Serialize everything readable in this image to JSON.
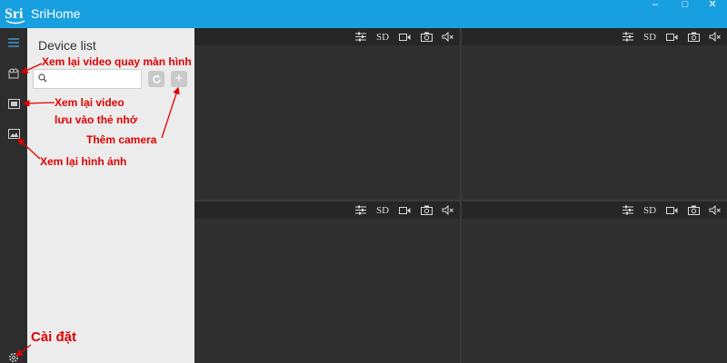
{
  "app": {
    "title": "SriHome",
    "logo_text": "Sri"
  },
  "window_controls": {
    "minimize": "–",
    "maximize": "□",
    "close": "✕"
  },
  "sidebar": {
    "items": [
      {
        "icon": "list-icon"
      },
      {
        "icon": "recording-icon"
      },
      {
        "icon": "film-icon"
      },
      {
        "icon": "image-icon"
      },
      {
        "icon": "gear-icon"
      }
    ]
  },
  "device_panel": {
    "title": "Device list",
    "search": {
      "value": "",
      "placeholder": ""
    },
    "refresh_icon": "refresh-icon",
    "add_label": "+"
  },
  "video_tiles": [
    {
      "quality": "SD"
    },
    {
      "quality": "SD"
    },
    {
      "quality": "SD"
    },
    {
      "quality": "SD"
    }
  ],
  "annotations": {
    "screen_recording": "Xem lại video quay màn hình",
    "card_video_line1": "Xem lại video",
    "card_video_line2": "lưu vào thẻ nhớ",
    "add_camera": "Thêm camera",
    "images": "Xem lại hình ảnh",
    "settings": "Cài đặt"
  },
  "colors": {
    "titlebar": "#189fe0",
    "accent": "#e00000",
    "panel_bg": "#ececec",
    "tile_bg": "#303030"
  }
}
